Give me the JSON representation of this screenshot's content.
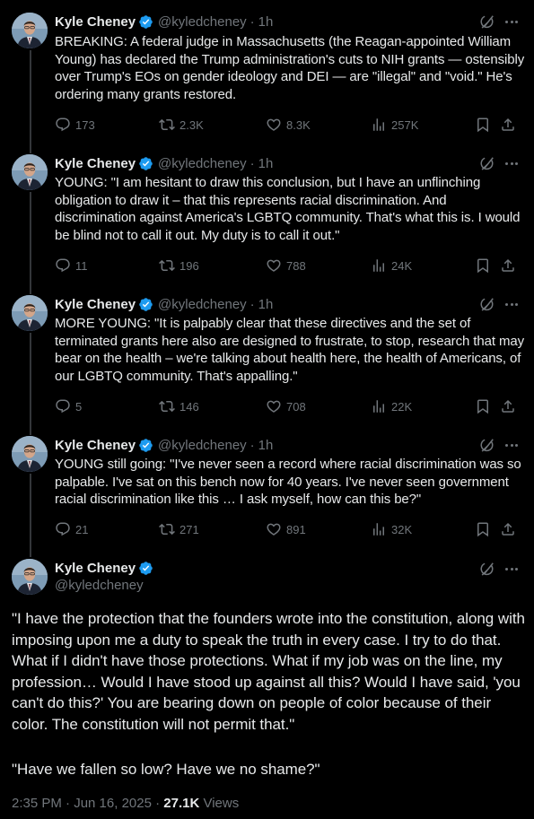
{
  "author": {
    "name": "Kyle Cheney",
    "handle": "@kyledcheney"
  },
  "colors": {
    "background": "#000000",
    "text": "#e7e9ea",
    "secondary": "#71767b",
    "verified": "#1d9bf0",
    "thread_line": "#333639"
  },
  "icons": [
    "reply-icon",
    "repost-icon",
    "like-icon",
    "views-icon",
    "bookmark-icon",
    "share-icon",
    "grok-icon",
    "more-icon",
    "verified-badge-icon"
  ],
  "tweets": [
    {
      "time": "1h",
      "text": "BREAKING: A federal judge in Massachusetts (the Reagan-appointed William Young) has declared the Trump administration's cuts to NIH grants — ostensibly over Trump's EOs on gender ideology and DEI — are \"illegal\" and \"void.\" He's ordering many grants restored.",
      "replies": "173",
      "reposts": "2.3K",
      "likes": "8.3K",
      "views": "257K"
    },
    {
      "time": "1h",
      "text": "YOUNG: \"I am hesitant to draw this conclusion, but I have an unflinching obligation to draw it – that this represents racial discrimination. And discrimination against America's LGBTQ community. That's what this is. I would be blind not to call it out. My duty is to call it out.\"",
      "replies": "11",
      "reposts": "196",
      "likes": "788",
      "views": "24K"
    },
    {
      "time": "1h",
      "text": "MORE YOUNG: \"It is palpably clear that these directives and the set of terminated grants here also are designed to frustrate, to stop, research that may bear on the health – we're talking about health here, the health of Americans, of our LGBTQ community. That's appalling.\"",
      "replies": "5",
      "reposts": "146",
      "likes": "708",
      "views": "22K"
    },
    {
      "time": "1h",
      "text": "YOUNG still going: \"I've never seen a record where racial discrimination was so palpable. I've sat on this bench now for 40 years. I've never seen government racial discrimination like this … I ask myself, how can this be?\"",
      "replies": "21",
      "reposts": "271",
      "likes": "891",
      "views": "32K"
    }
  ],
  "main_tweet": {
    "paragraph1": "\"I have the protection that the founders wrote into the constitution, along with imposing upon me a duty to speak the truth in every case. I try to do that. What if I didn't have those protections. What if my job was on the line, my profession… Would I have stood up against all this? Would I have said, 'you can't do this?' You are bearing down on people of color because of their color. The constitution will not permit that.\"",
    "paragraph2": "\"Have we fallen so low? Have we no shame?\"",
    "timestamp": "2:35 PM · Jun 16, 2025 · ",
    "views_count": "27.1K",
    "views_label": " Views"
  }
}
